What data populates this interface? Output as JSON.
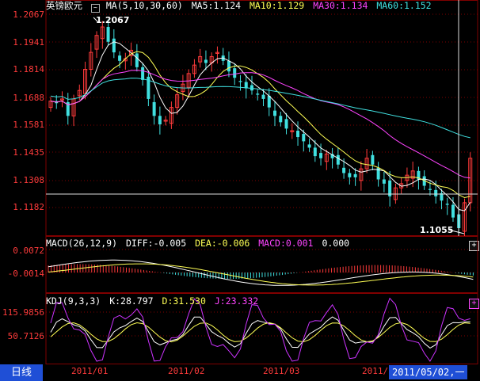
{
  "main": {
    "symbol": "英镑欧元",
    "ma_label": "MA(5,10,30,60)",
    "ma5": "MA5:1.124",
    "ma10": "MA10:1.129",
    "ma30": "MA30:1.134",
    "ma60": "MA60:1.152",
    "y_ticks": [
      "1.2067",
      "1.1941",
      "1.1814",
      "1.1688",
      "1.1581",
      "1.1435",
      "1.1308",
      "1.1182"
    ],
    "high_label": "1.2067",
    "low_label": "1.1055",
    "colors": {
      "up": "#ff3b3b",
      "down": "#40e0e0",
      "ma5": "#ffffff",
      "ma10": "#ffff55",
      "ma30": "#ff44ff",
      "ma60": "#40e0e0",
      "grid": "#800000"
    }
  },
  "macd": {
    "label": "MACD(26,12,9)",
    "diff": "DIFF:-0.005",
    "dea": "DEA:-0.006",
    "macd": "MACD:0.001",
    "extra": "0.000",
    "y_ticks": [
      "0.0072",
      "-0.0014"
    ]
  },
  "kdj": {
    "label": "KDJ(9,3,3)",
    "k": "K:28.797",
    "d": "D:31.530",
    "j": "J:23.332",
    "y_ticks": [
      "115.9856",
      "50.7126"
    ]
  },
  "footer": {
    "period_tab": "日线",
    "months": [
      "2011/01",
      "2011/02",
      "2011/03",
      "2011/"
    ],
    "cursor_date": "2011/05/02,一"
  },
  "chart_data": {
    "type": "line",
    "title": "英镑欧元",
    "close": [
      1.167,
      1.166,
      1.168,
      1.16,
      1.168,
      1.172,
      1.182,
      1.19,
      1.198,
      1.202,
      1.195,
      1.19,
      1.186,
      1.187,
      1.191,
      1.183,
      1.177,
      1.168,
      1.16,
      1.156,
      1.158,
      1.164,
      1.17,
      1.175,
      1.18,
      1.184,
      1.188,
      1.185,
      1.188,
      1.19,
      1.186,
      1.181,
      1.178,
      1.176,
      1.173,
      1.172,
      1.17,
      1.168,
      1.164,
      1.16,
      1.157,
      1.154,
      1.153,
      1.15,
      1.148,
      1.145,
      1.141,
      1.14,
      1.142,
      1.14,
      1.137,
      1.133,
      1.131,
      1.131,
      1.135,
      1.14,
      1.137,
      1.13,
      1.128,
      1.122,
      1.126,
      1.128,
      1.132,
      1.134,
      1.13,
      1.127,
      1.125,
      1.122,
      1.12,
      1.118,
      1.112,
      1.107,
      1.119,
      1.14
    ],
    "ylim": [
      1.104,
      1.208
    ],
    "high": 1.2067,
    "low": 1.1055,
    "ma_periods": [
      5,
      10,
      30,
      60
    ]
  }
}
